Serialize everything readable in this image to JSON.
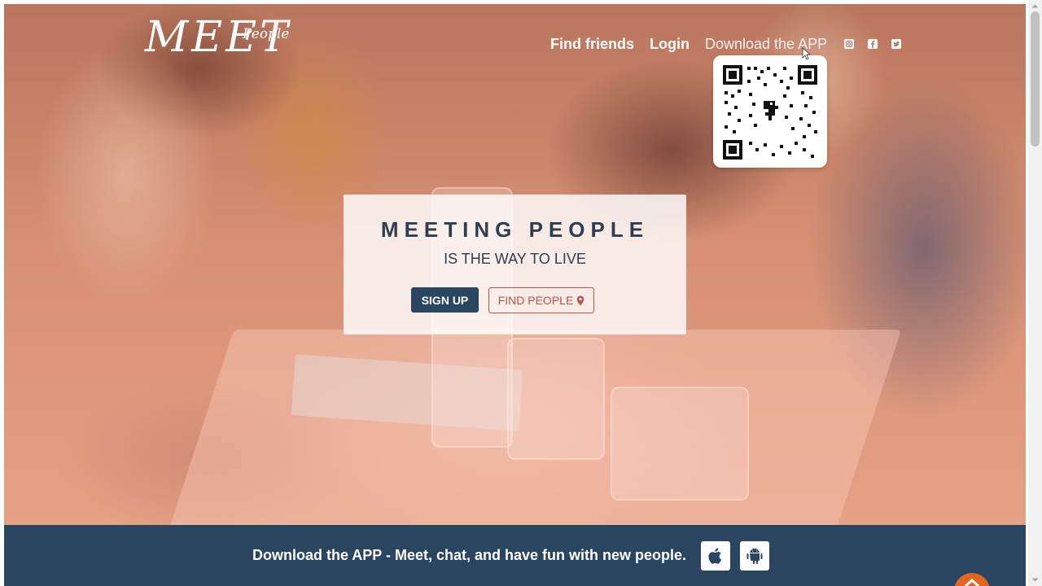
{
  "brand": {
    "logo_main": "MEET",
    "logo_sub": "People"
  },
  "nav": {
    "find_friends": "Find friends",
    "login": "Login",
    "download_app": "Download the APP",
    "social_icons": [
      "instagram-icon",
      "facebook-icon",
      "twitter-icon"
    ]
  },
  "hero": {
    "title": "MEETING PEOPLE",
    "subtitle": "IS THE WAY TO LIVE",
    "signup_label": "SIGN UP",
    "find_people_label": "FIND PEOPLE"
  },
  "footer_band": {
    "text": "Download the APP - Meet, chat, and have fun with new people.",
    "store_icons": [
      "apple-icon",
      "android-icon"
    ]
  },
  "colors": {
    "navy": "#2a4560",
    "accent_red": "#c0504d",
    "scroll_top_orange": "#e2661f",
    "title_text": "#2d3e50"
  }
}
